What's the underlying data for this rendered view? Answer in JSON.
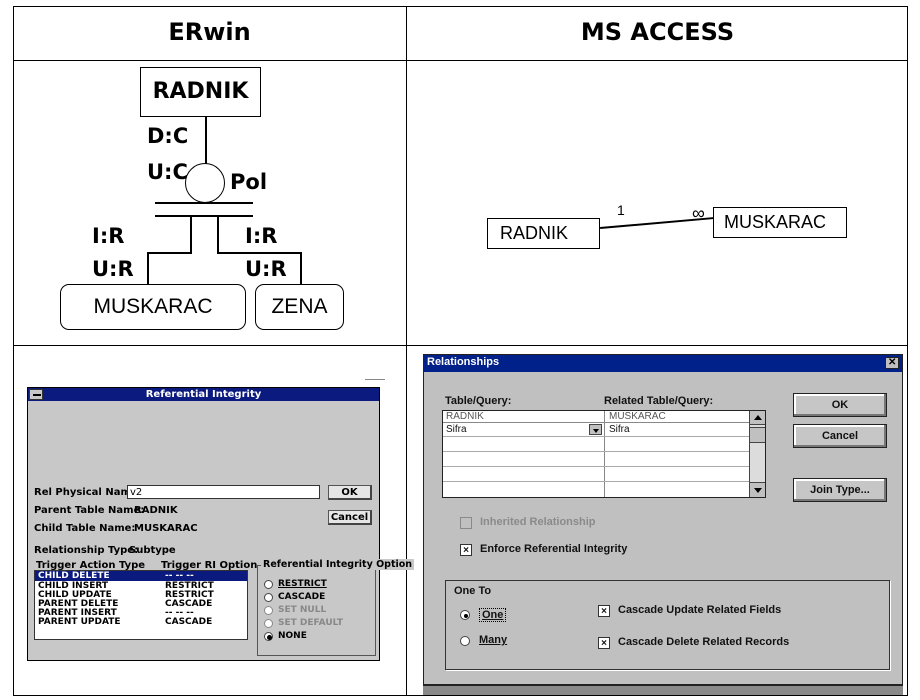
{
  "headers": {
    "erwin": "ERwin",
    "access": "MS ACCESS"
  },
  "erwin_diagram": {
    "parent": "RADNIK",
    "dc": "D:C",
    "uc": "U:C",
    "discriminator": "Pol",
    "ir_left": "I:R",
    "ur_left": "U:R",
    "ir_right": "I:R",
    "ur_right": "U:R",
    "child1": "MUSKARAC",
    "child2": "ZENA"
  },
  "access_diagram": {
    "left": "RADNIK",
    "right": "MUSKARAC",
    "one": "1",
    "many": "∞"
  },
  "erwin_dialog": {
    "title": "Referential Integrity",
    "rel_physical_name_label": "Rel Physical Name:",
    "rel_physical_name_value": "v2",
    "ok": "OK",
    "cancel": "Cancel",
    "parent_table_label": "Parent Table Name:",
    "parent_table_value": "RADNIK",
    "child_table_label": "Child Table Name:",
    "child_table_value": "MUSKARAC",
    "relationship_type_label": "Relationship Type:",
    "relationship_type_value": "Subtype",
    "col_action": "Trigger Action Type",
    "col_option": "Trigger RI Option",
    "rows": [
      {
        "action": "CHILD DELETE",
        "option": "-- -- --"
      },
      {
        "action": "CHILD INSERT",
        "option": "RESTRICT"
      },
      {
        "action": "CHILD UPDATE",
        "option": "RESTRICT"
      },
      {
        "action": "PARENT DELETE",
        "option": "CASCADE"
      },
      {
        "action": "PARENT INSERT",
        "option": "-- -- --"
      },
      {
        "action": "PARENT UPDATE",
        "option": "CASCADE"
      }
    ],
    "ri_group_title": "Referential Integrity Option",
    "ri_options": [
      "RESTRICT",
      "CASCADE",
      "SET NULL",
      "SET DEFAULT",
      "NONE"
    ],
    "ri_selected": "NONE"
  },
  "access_dialog": {
    "title": "Relationships",
    "close": "✕",
    "col_table": "Table/Query:",
    "col_related": "Related Table/Query:",
    "table_name": "RADNIK",
    "related_name": "MUSKARAC",
    "field_left": "Sifra",
    "field_right": "Sifra",
    "ok": "OK",
    "cancel": "Cancel",
    "join_type": "Join Type...",
    "inherited": "Inherited Relationship",
    "enforce": "Enforce Referential Integrity",
    "one_to_title": "One To",
    "one": "One",
    "many": "Many",
    "cascade_update": "Cascade Update Related Fields",
    "cascade_delete": "Cascade Delete Related Records"
  }
}
